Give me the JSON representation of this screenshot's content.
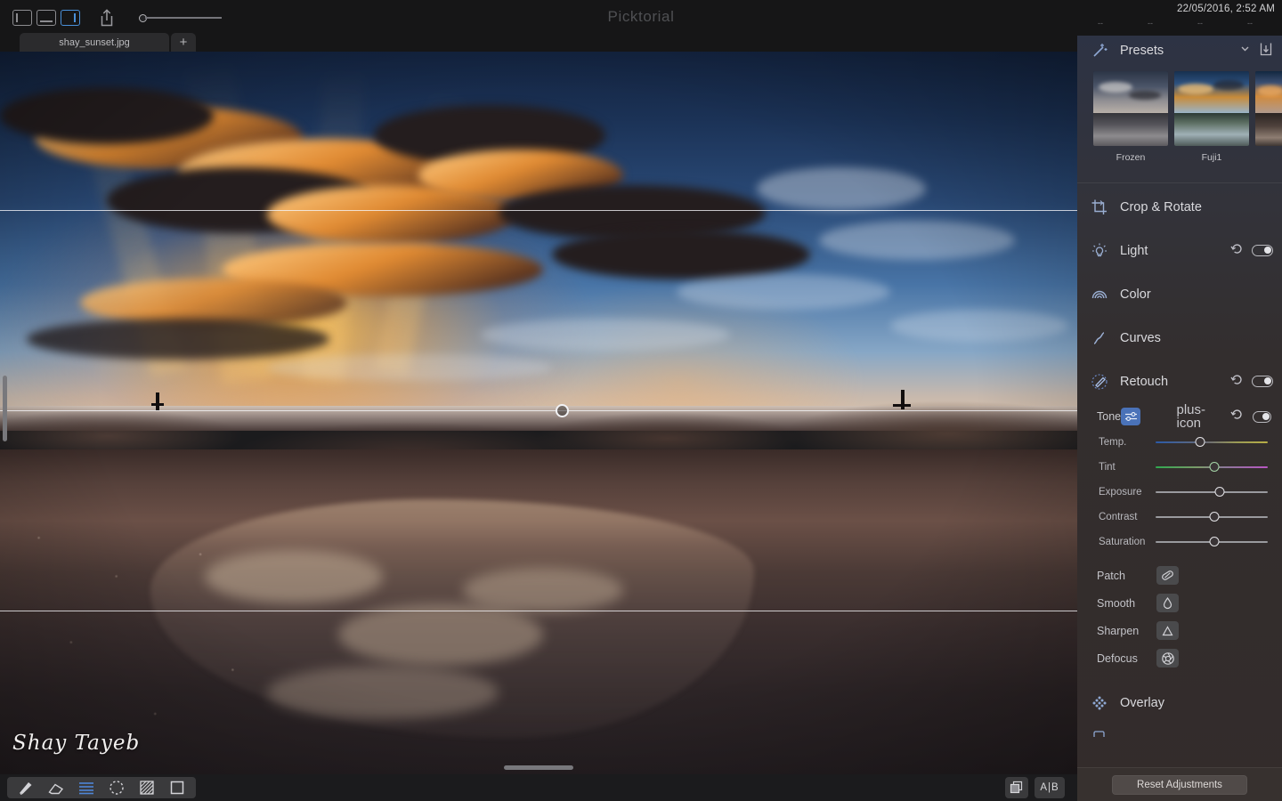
{
  "app": {
    "title": "Picktorial",
    "datetime": "22/05/2016, 2:52 AM",
    "status_dashes": [
      "--",
      "--",
      "--",
      "--"
    ]
  },
  "toolbar": {
    "view_modes": [
      {
        "name": "view-single",
        "icon": "panel-left-icon",
        "active": false
      },
      {
        "name": "view-filmstrip",
        "icon": "panel-bottom-icon",
        "active": false
      },
      {
        "name": "view-split",
        "icon": "panel-right-icon",
        "active": true
      }
    ],
    "share_icon": "share-upload-icon",
    "zoom_value": "0"
  },
  "tabs": {
    "items": [
      {
        "label": "shay_sunset.jpg",
        "active": true
      }
    ],
    "add_label": "+"
  },
  "canvas": {
    "image_title": "shay_sunset.jpg",
    "signature": "Shay Tayeb",
    "guides": [
      {
        "name": "guide-top",
        "y_pct": 28.9
      },
      {
        "name": "guide-middle",
        "y_pct": 49.6,
        "handle_x_pct": 52.1
      },
      {
        "name": "guide-bottom",
        "y_pct": 77.3
      }
    ]
  },
  "bottom_tools": {
    "items": [
      {
        "label": "Brush",
        "icon": "brush-icon",
        "active": false
      },
      {
        "label": "Eraser",
        "icon": "eraser-icon",
        "active": false
      },
      {
        "label": "Gradient",
        "icon": "linear-gradient-icon",
        "active": true
      },
      {
        "label": "Radial",
        "icon": "radial-selection-icon",
        "active": false
      },
      {
        "label": "Mask",
        "icon": "checker-mask-icon",
        "active": false
      },
      {
        "label": "Frame",
        "icon": "square-frame-icon",
        "active": false
      }
    ],
    "right": [
      {
        "label": "Duplicate",
        "icon": "duplicate-layer-icon"
      },
      {
        "label": "A|B",
        "icon": "before-after-icon"
      }
    ]
  },
  "panel": {
    "presets": {
      "title": "Presets",
      "icon": "magic-wand-icon",
      "collapse_icon": "chevron-down-icon",
      "import_icon": "import-preset-icon",
      "items": [
        {
          "label": "Frozen",
          "style": "pt-frozen"
        },
        {
          "label": "Fuji1",
          "style": "pt-fuji"
        },
        {
          "label": "",
          "style": "pt-third"
        }
      ]
    },
    "sections": [
      {
        "title": "Crop & Rotate",
        "icon": "crop-rotate-icon",
        "has_reset": false,
        "has_toggle": false
      },
      {
        "title": "Light",
        "icon": "light-bulb-icon",
        "has_reset": true,
        "has_toggle": true
      },
      {
        "title": "Color",
        "icon": "color-rainbow-icon",
        "has_reset": false,
        "has_toggle": false
      },
      {
        "title": "Curves",
        "icon": "curves-icon",
        "has_reset": false,
        "has_toggle": false
      },
      {
        "title": "Retouch",
        "icon": "retouch-brush-icon",
        "has_reset": true,
        "has_toggle": true,
        "active": true
      }
    ],
    "tone": {
      "label": "Tone",
      "mode_icon": "sliders-icon",
      "add_icon": "plus-icon",
      "reset_icon": "reset-arrow-icon",
      "toggle_icon": "toggle-on-icon",
      "sliders": [
        {
          "label": "Temp.",
          "value_pct": 40,
          "gradient": "temp"
        },
        {
          "label": "Tint",
          "value_pct": 52,
          "gradient": "tint"
        },
        {
          "label": "Exposure",
          "value_pct": 57,
          "gradient": "plain"
        },
        {
          "label": "Contrast",
          "value_pct": 52,
          "gradient": "plain"
        },
        {
          "label": "Saturation",
          "value_pct": 52,
          "gradient": "plain"
        }
      ]
    },
    "retouch_tools": [
      {
        "label": "Patch",
        "icon": "patch-bandage-icon"
      },
      {
        "label": "Smooth",
        "icon": "smooth-droplet-icon"
      },
      {
        "label": "Sharpen",
        "icon": "sharpen-triangle-icon"
      },
      {
        "label": "Defocus",
        "icon": "defocus-aperture-icon"
      }
    ],
    "overlay": {
      "title": "Overlay",
      "icon": "overlay-diamond-icon"
    },
    "reset_button": "Reset Adjustments"
  }
}
